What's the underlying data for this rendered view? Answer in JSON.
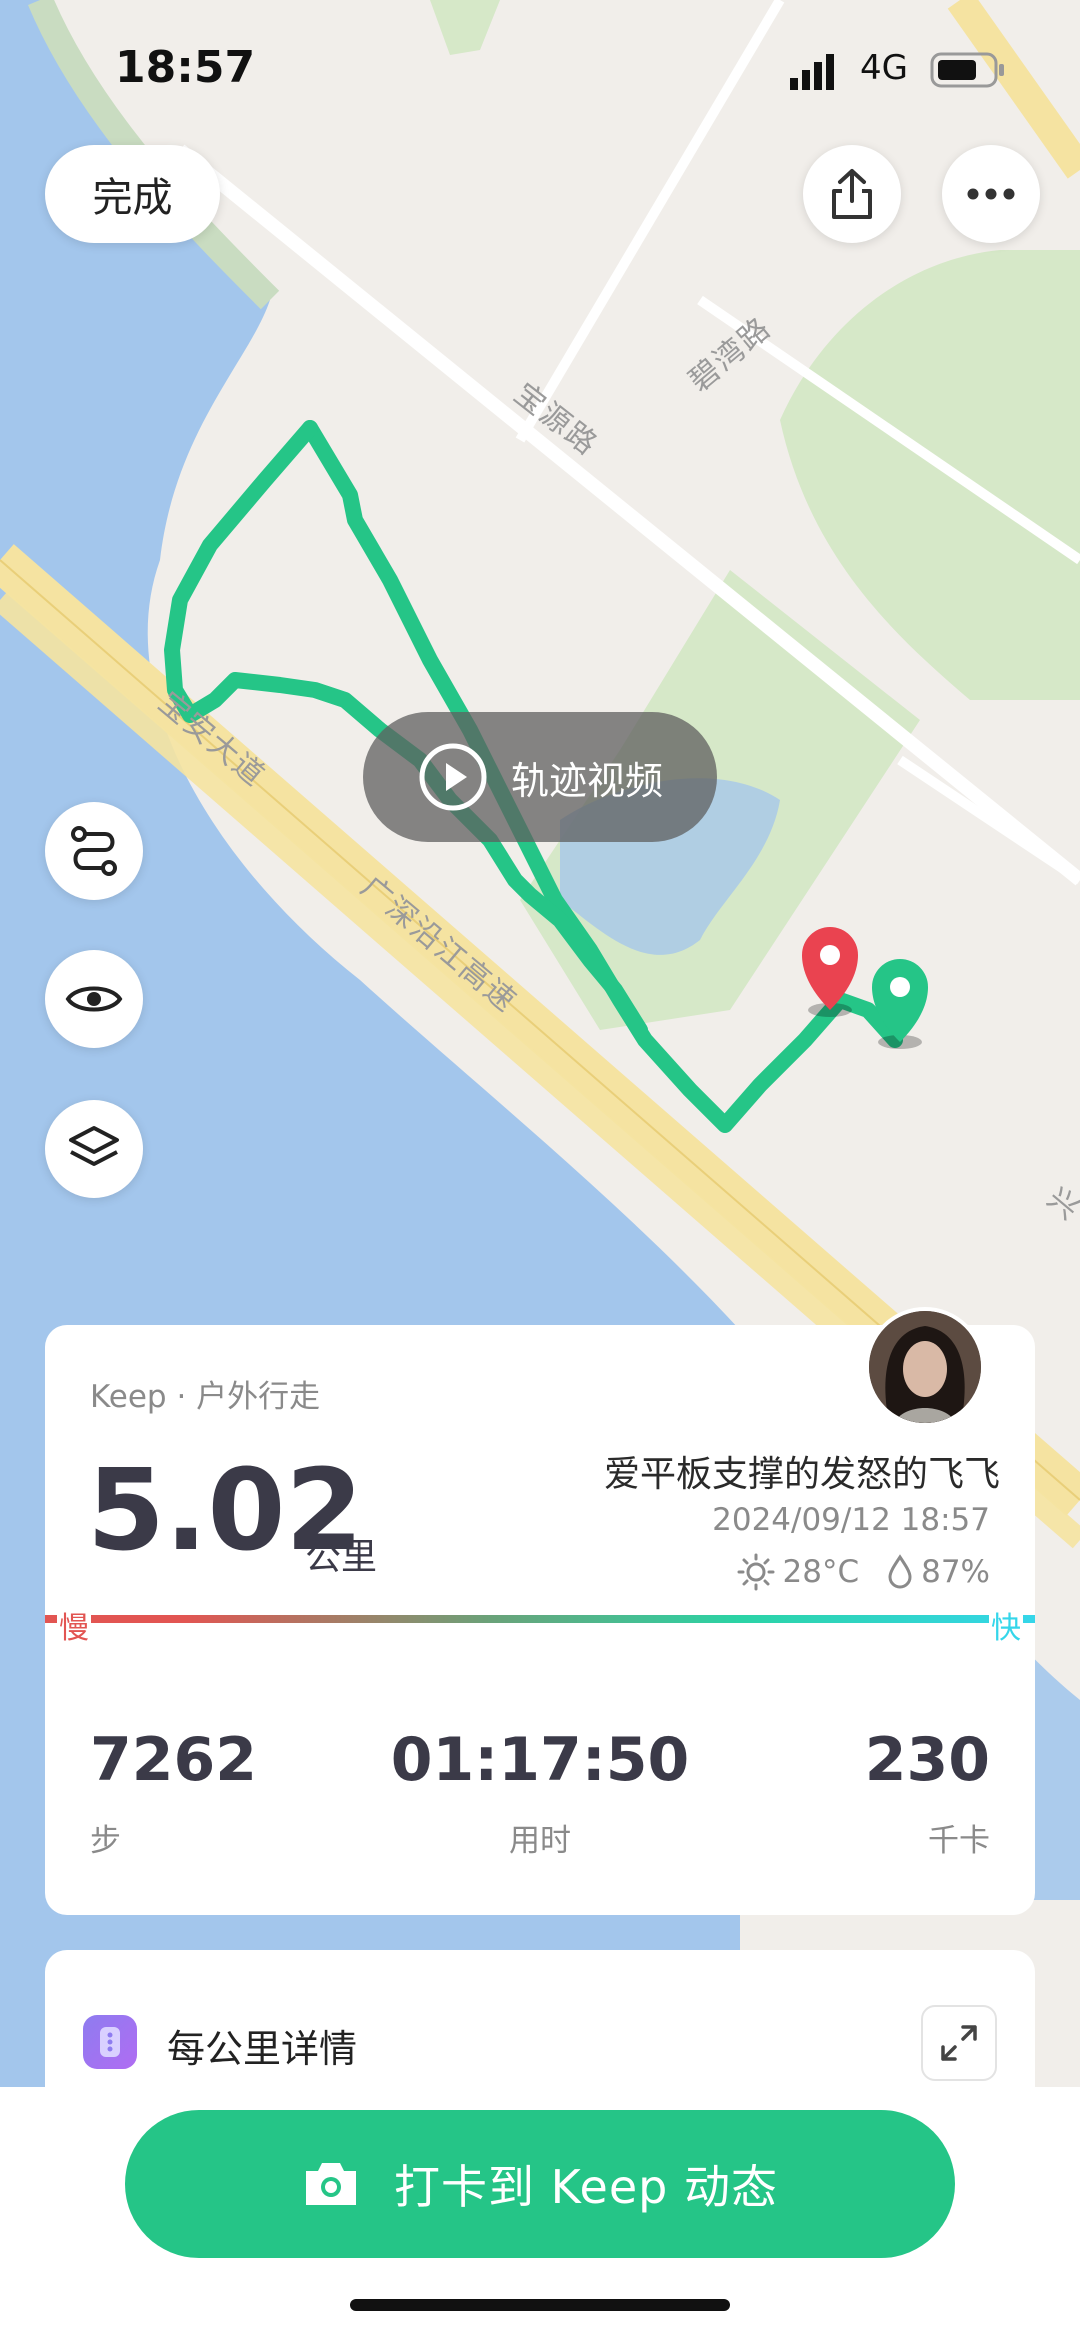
{
  "status_bar": {
    "time": "18:57",
    "network": "4G"
  },
  "header": {
    "done_label": "完成"
  },
  "map": {
    "labels": {
      "road_1": "宝源路",
      "road_2": "碧湾路",
      "road_3": "广深沿江高速",
      "road_4": "宝安大道",
      "road_5": "兴"
    },
    "track_video_label": "轨迹视频",
    "route_color": "#25c587"
  },
  "summary": {
    "source": "Keep · 户外行走",
    "distance_value": "5.02",
    "distance_unit": "公里",
    "user_name": "爱平板支撑的发怒的飞飞",
    "datetime": "2024/09/12 18:57",
    "temperature": "28°C",
    "humidity": "87%",
    "pace_slow": "慢",
    "pace_fast": "快",
    "stats": [
      {
        "value": "7262",
        "label": "步"
      },
      {
        "value": "01:17:50",
        "label": "用时"
      },
      {
        "value": "230",
        "label": "千卡"
      }
    ]
  },
  "details": {
    "title": "每公里详情"
  },
  "cta": {
    "label": "打卡到 Keep 动态",
    "color": "#25c587"
  }
}
